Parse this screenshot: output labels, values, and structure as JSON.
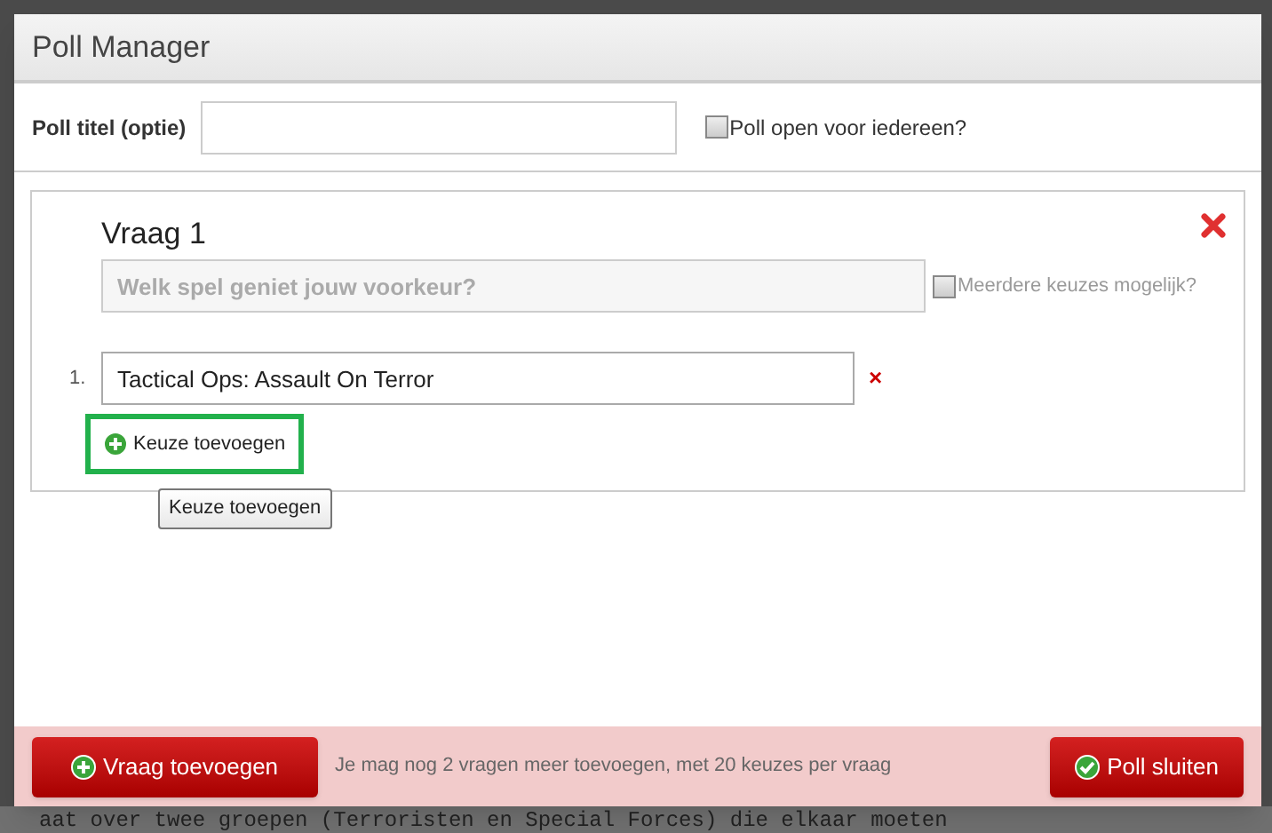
{
  "dialog": {
    "title": "Poll Manager",
    "poll_title": {
      "label": "Poll titel (optie)"
    },
    "open_for_all": {
      "label": "Poll open voor iedereen?",
      "checked": false
    },
    "questions": [
      {
        "heading": "Vraag 1",
        "placeholder": "Welk spel geniet jouw voorkeur?",
        "multiple": {
          "label": "Meerdere keuzes mogelijk?",
          "checked": false
        },
        "choices": [
          {
            "number": "1.",
            "value": "Tactical Ops: Assault On Terror",
            "remove": "×"
          }
        ],
        "add_choice": {
          "label": "Keuze toevoegen",
          "highlighted": true
        },
        "tooltip": "Keuze toevoegen"
      }
    ],
    "footer": {
      "add_question": "Vraag toevoegen",
      "note": "Je mag nog 2 vragen meer toevoegen, met 20 keuzes per vraag",
      "close": "Poll sluiten"
    }
  },
  "background_text": "aat over twee groepen (Terroristen en Special Forces) die elkaar moeten"
}
